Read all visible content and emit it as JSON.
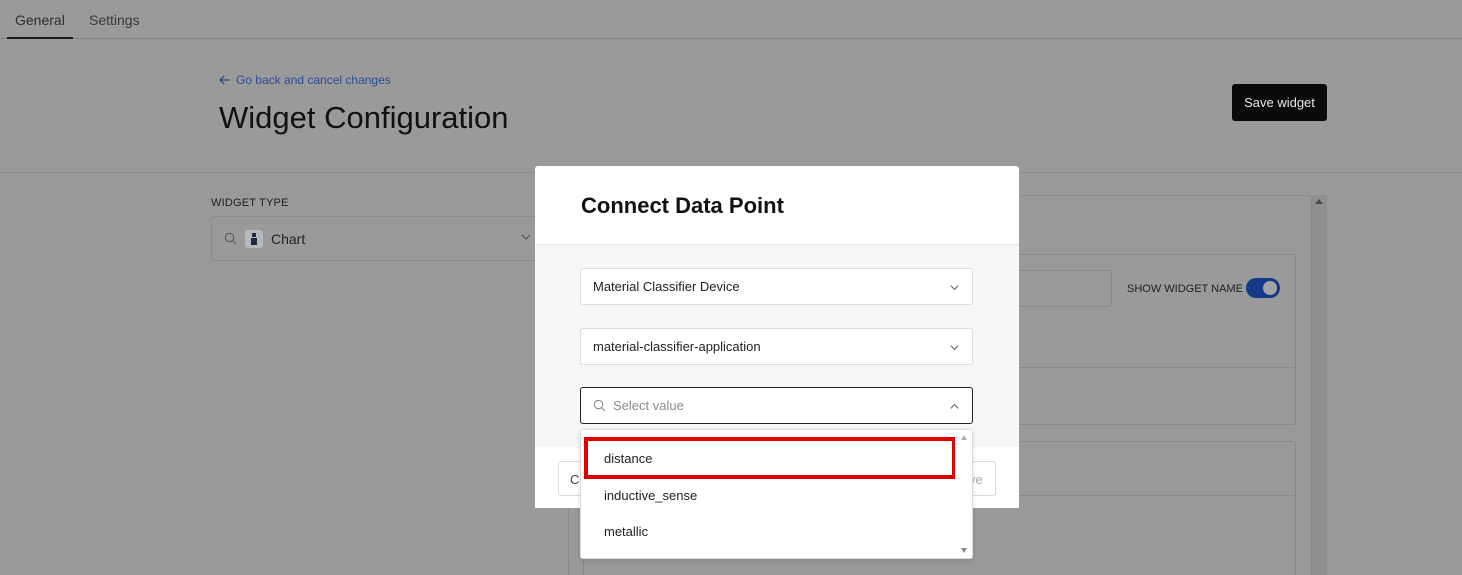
{
  "tabs": [
    {
      "label": "General"
    },
    {
      "label": "Settings"
    }
  ],
  "header": {
    "back_link": "Go back and cancel changes",
    "title": "Widget Configuration",
    "save_button": "Save widget"
  },
  "widget_type": {
    "label": "WIDGET TYPE",
    "value": "Chart"
  },
  "settings_panel": {
    "show_widget_name_label": "SHOW WIDGET NAME",
    "show_widget_name_on": true
  },
  "modal": {
    "title": "Connect Data Point",
    "device_select": "Material Classifier Device",
    "application_select": "material-classifier-application",
    "value_placeholder": "Select value",
    "cancel_label": "Cancel",
    "save_label": "Save"
  },
  "dropdown": {
    "options": [
      {
        "label": "distance",
        "highlighted": true
      },
      {
        "label": "inductive_sense"
      },
      {
        "label": "metallic"
      }
    ]
  },
  "colors": {
    "overlay_background": "#9a9a9a",
    "highlight": "#e00000",
    "toggle_on": "#123a86"
  }
}
